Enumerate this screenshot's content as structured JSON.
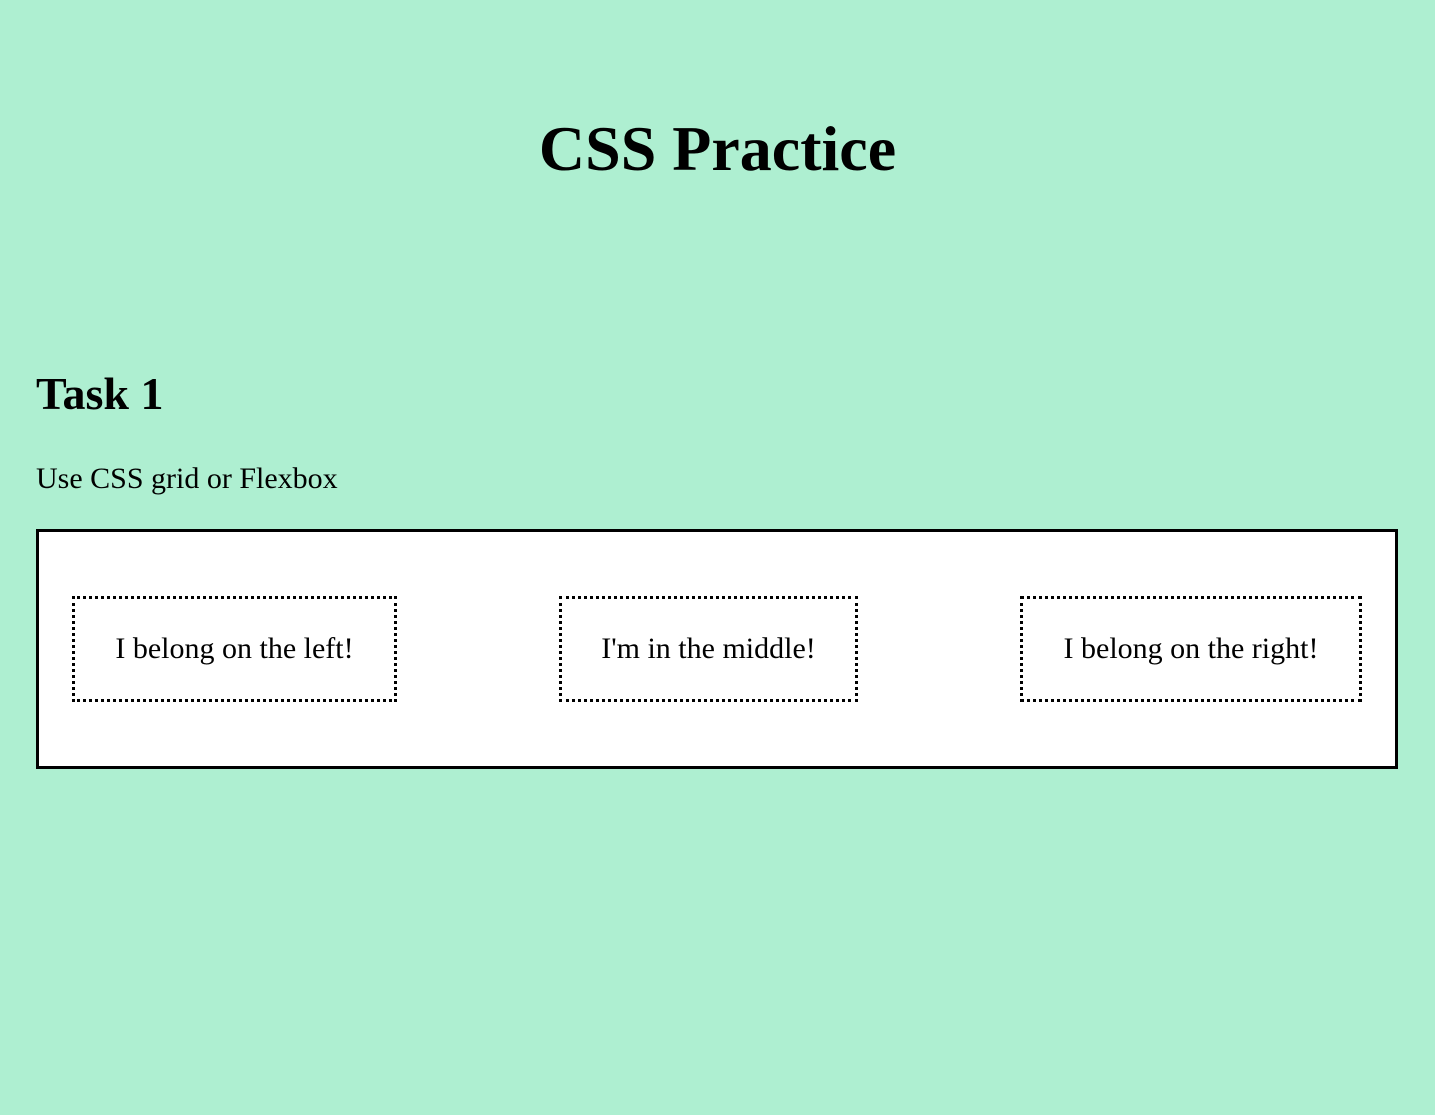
{
  "page": {
    "title": "CSS Practice",
    "background_color": "#aeefd1"
  },
  "task": {
    "heading": "Task 1",
    "description": "Use CSS grid or Flexbox",
    "container_background": "#ffffff",
    "items": [
      {
        "label": "I belong on the left!"
      },
      {
        "label": "I'm in the middle!"
      },
      {
        "label": "I belong on the right!"
      }
    ]
  }
}
